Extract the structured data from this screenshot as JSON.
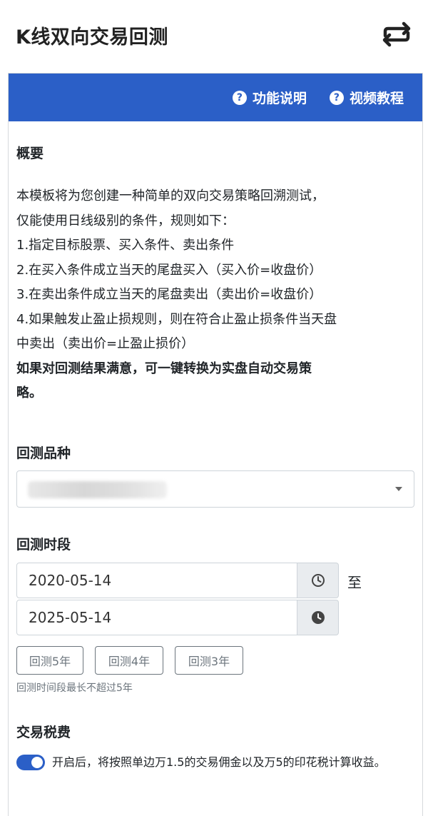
{
  "header": {
    "title": "K线双向交易回测",
    "swap_icon": "swap-arrows-icon"
  },
  "panel": {
    "accent_color": "#2b5fc7",
    "links": [
      {
        "label": "功能说明",
        "icon": "question-circle-icon"
      },
      {
        "label": "视频教程",
        "icon": "question-circle-icon"
      }
    ]
  },
  "overview": {
    "title": "概要",
    "lines": [
      "本模板将为您创建一种简单的双向交易策略回溯测试，",
      "仅能使用日线级别的条件，规则如下：",
      "1.指定目标股票、买入条件、卖出条件",
      "2.在买入条件成立当天的尾盘买入（买入价=收盘价）",
      "3.在卖出条件成立当天的尾盘卖出（卖出价=收盘价）",
      "4.如果触发止盈止损规则，则在符合止盈止损条件当天盘",
      "中卖出（卖出价=止盈止损价）"
    ],
    "emphasis_line1": "如果对回测结果满意，可一键转换为实盘自动交易策",
    "emphasis_line2": "略。"
  },
  "variety": {
    "title": "回测品种"
  },
  "period": {
    "title": "回测时段",
    "start_date": "2020-05-14",
    "end_date": "2025-05-14",
    "to_label": "至",
    "quick_buttons": [
      "回测5年",
      "回测4年",
      "回测3年"
    ],
    "hint": "回测时间段最长不超过5年"
  },
  "tax": {
    "title": "交易税费",
    "enabled": true,
    "text": "开启后，将按照单边万1.5的交易佣金以及万5的印花税计算收益。"
  }
}
